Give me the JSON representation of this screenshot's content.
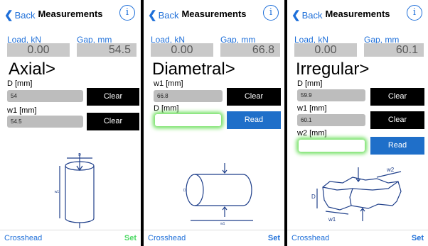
{
  "panels": [
    {
      "back_label": "Back",
      "title": "Measurements",
      "info_glyph": "i",
      "load_label": "Load, kN",
      "gap_label": "Gap, mm",
      "load_value": "0.00",
      "gap_value": "54.5",
      "mode": "Axial>",
      "f1_label": "D [mm]",
      "f1_value": "54",
      "f1_button": "Clear",
      "f2_label": "w1 [mm]",
      "f2_value": "54.5",
      "f2_button": "Clear",
      "toolbar_left": "Crosshead",
      "toolbar_right": "Set",
      "toolbar_right_color": "#4cd964",
      "diagram_labels": [
        "D",
        "w1"
      ]
    },
    {
      "back_label": "Back",
      "title": "Measurements",
      "info_glyph": "i",
      "load_label": "Load, kN",
      "gap_label": "Gap, mm",
      "load_value": "0.00",
      "gap_value": "66.8",
      "mode": "Diametral>",
      "f1_label": "w1 [mm]",
      "f1_value": "66.8",
      "f1_button": "Clear",
      "f2_label": "D [mm]",
      "f2_value": "",
      "f2_button": "Read",
      "toolbar_left": "Crosshead",
      "toolbar_right": "Set",
      "toolbar_right_color": "#1e6fd9",
      "diagram_labels": [
        "D",
        "w1"
      ]
    },
    {
      "back_label": "Back",
      "title": "Measurements",
      "info_glyph": "i",
      "load_label": "Load, kN",
      "gap_label": "Gap, mm",
      "load_value": "0.00",
      "gap_value": "60.1",
      "mode": "Irregular>",
      "f1_label": "D [mm]",
      "f1_value": "59.9",
      "f1_button": "Clear",
      "f2_label": "w1 [mm]",
      "f2_value": "60.1",
      "f2_button": "Clear",
      "f3_label": "w2 [mm]",
      "f3_value": "",
      "f3_button": "Read",
      "toolbar_left": "Crosshead",
      "toolbar_right": "Set",
      "toolbar_right_color": "#1e6fd9",
      "diagram_labels": [
        "D",
        "w1",
        "w2"
      ]
    }
  ],
  "colors": {
    "accent": "#1e6fd9",
    "glow": "#6fe05f",
    "button_black": "#000000",
    "button_blue": "#1f6fc9",
    "field_bg": "#bdbdbd"
  }
}
